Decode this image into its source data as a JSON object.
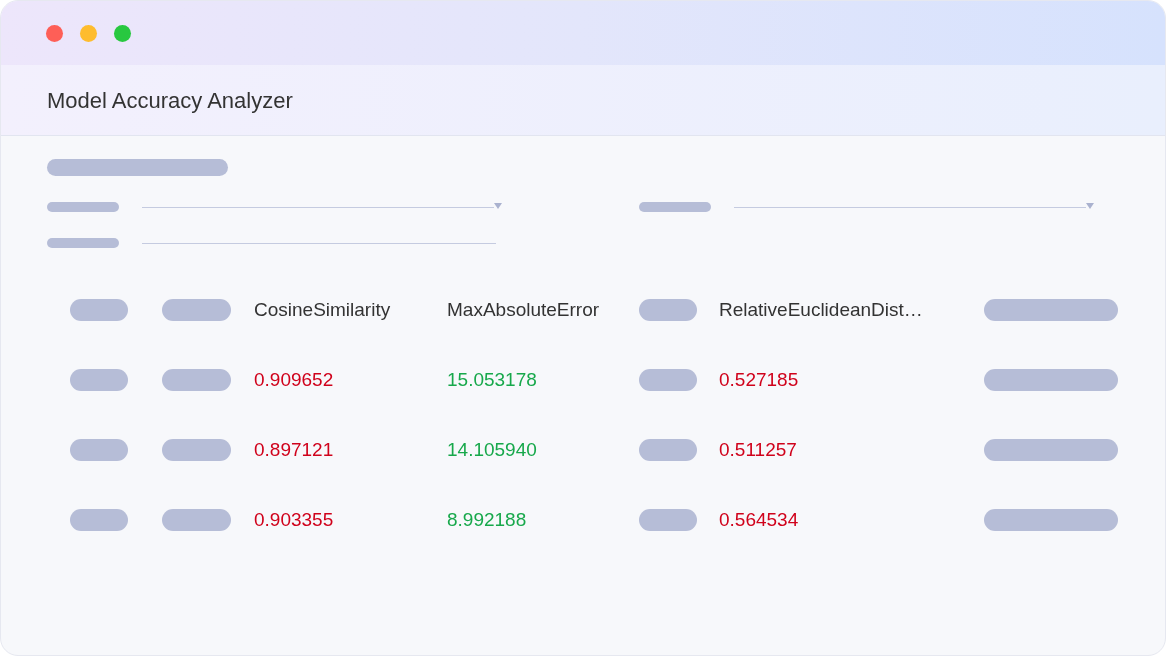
{
  "window": {
    "title": "Model Accuracy Analyzer"
  },
  "table": {
    "columns": [
      "CosineSimilarity",
      "MaxAbsoluteError",
      "RelativeEuclideanDist…"
    ],
    "rows": [
      {
        "cells": [
          {
            "text": "0.909652",
            "color": "#d0021b"
          },
          {
            "text": "15.053178",
            "color": "#17a84b"
          },
          {
            "text": "0.527185",
            "color": "#d0021b"
          }
        ]
      },
      {
        "cells": [
          {
            "text": "0.897121",
            "color": "#d0021b"
          },
          {
            "text": "14.105940",
            "color": "#17a84b"
          },
          {
            "text": "0.511257",
            "color": "#d0021b"
          }
        ]
      },
      {
        "cells": [
          {
            "text": "0.903355",
            "color": "#d0021b"
          },
          {
            "text": "8.992188",
            "color": "#17a84b"
          },
          {
            "text": "0.564534",
            "color": "#d0021b"
          }
        ]
      }
    ]
  }
}
